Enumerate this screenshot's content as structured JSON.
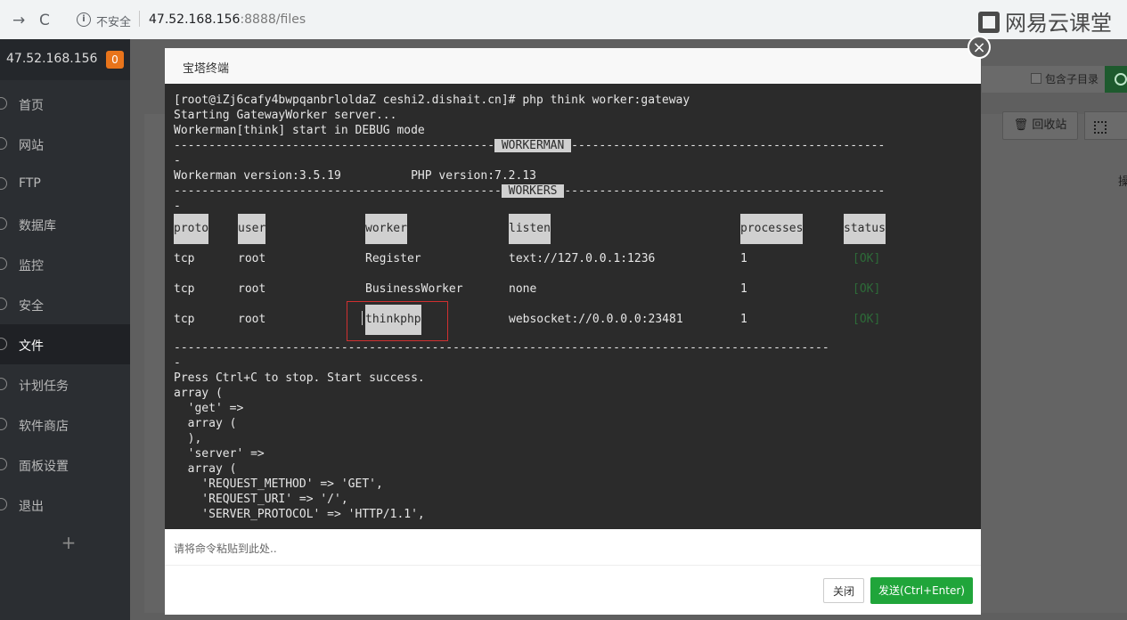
{
  "browser": {
    "security_label": "不安全",
    "host": "47.52.168.156",
    "path": ":8888/files",
    "brand": "网易云课堂"
  },
  "sidebar": {
    "ip": "47.52.168.156",
    "badge": "0",
    "items": [
      {
        "label": "首页",
        "icon": "home-icon"
      },
      {
        "label": "网站",
        "icon": "globe-icon"
      },
      {
        "label": "FTP",
        "icon": "ftp-icon"
      },
      {
        "label": "数据库",
        "icon": "database-icon"
      },
      {
        "label": "监控",
        "icon": "monitor-icon"
      },
      {
        "label": "安全",
        "icon": "shield-icon"
      },
      {
        "label": "文件",
        "icon": "folder-icon"
      },
      {
        "label": "计划任务",
        "icon": "calendar-icon"
      },
      {
        "label": "软件商店",
        "icon": "store-icon"
      },
      {
        "label": "面板设置",
        "icon": "settings-icon"
      },
      {
        "label": "退出",
        "icon": "logout-icon"
      }
    ],
    "add": "+"
  },
  "files_page": {
    "include_subdir": "包含子目录",
    "recycle_label": "回收站",
    "right_glyph": "操"
  },
  "modal": {
    "title": "宝塔终端",
    "close": "×",
    "input_placeholder": "请将命令粘贴到此处..",
    "close_button": "关闭",
    "send_button": "发送(Ctrl+Enter)"
  },
  "terminal": {
    "line1": "[root@iZj6cafy4bwpqanbrloldaZ ceshi2.dishait.cn]# php think worker:gateway",
    "line2": "Starting GatewayWorker server...",
    "line3": "Workerman[think] start in DEBUG mode",
    "sep1_left": "----------------------------------------------",
    "sep1_label": " WORKERMAN ",
    "sep1_right": "---------------------------------------------",
    "dash": "-",
    "version_line": "Workerman version:3.5.19          PHP version:7.2.13",
    "sep2_left": "-----------------------------------------------",
    "sep2_label": " WORKERS ",
    "sep2_right": "----------------------------------------------",
    "headers": [
      "proto",
      "user",
      "worker",
      "listen",
      "processes",
      "status"
    ],
    "rows": [
      {
        "proto": "tcp",
        "user": "root",
        "worker": "Register",
        "listen": "text://127.0.0.1:1236",
        "processes": "1",
        "status": "[OK]"
      },
      {
        "proto": "tcp",
        "user": "root",
        "worker": "BusinessWorker",
        "listen": "none",
        "processes": "1",
        "status": "[OK]"
      },
      {
        "proto": "tcp",
        "user": "root",
        "worker": "thinkphp",
        "listen": "websocket://0.0.0.0:23481",
        "processes": "1",
        "status": "[OK]"
      }
    ],
    "sep3": "----------------------------------------------------------------------------------------------",
    "after": [
      "Press Ctrl+C to stop. Start success.",
      "array (",
      "  'get' =>",
      "  array (",
      "  ),",
      "  'server' =>",
      "  array (",
      "    'REQUEST_METHOD' => 'GET',",
      "    'REQUEST_URI' => '/',",
      "    'SERVER_PROTOCOL' => 'HTTP/1.1',"
    ]
  }
}
